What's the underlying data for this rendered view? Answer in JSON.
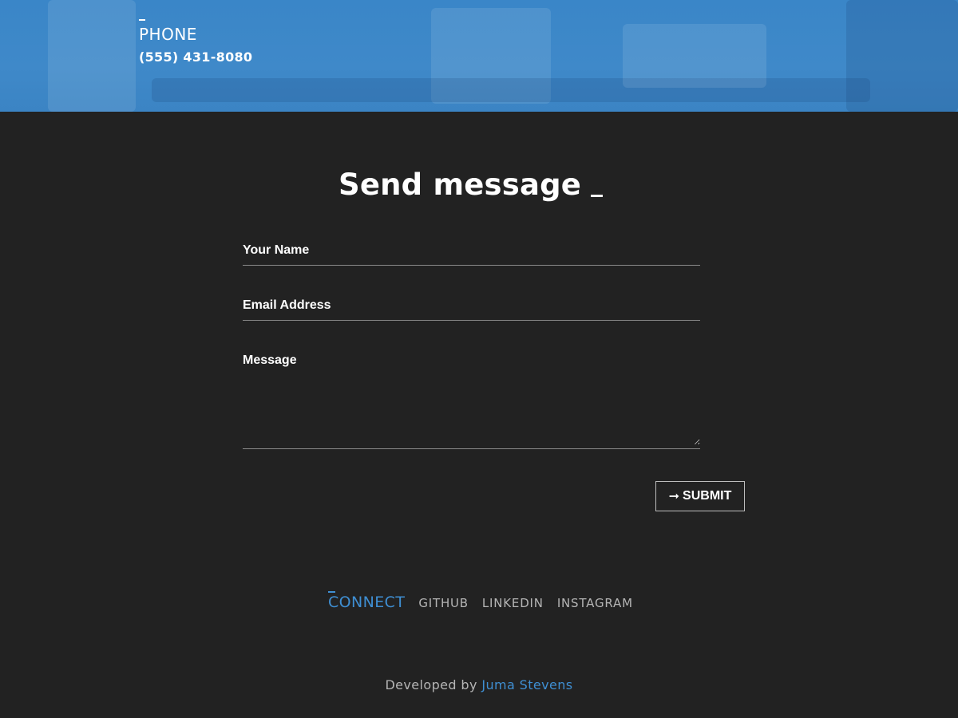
{
  "hero": {
    "phone_title": "PHONE",
    "phone_number": "(555) 431-8080",
    "background_color": "#3b86c7"
  },
  "contact_form": {
    "title": "Send message",
    "name_placeholder": "Your Name",
    "email_placeholder": "Email Address",
    "message_placeholder": "Message",
    "submit_icon": "arrow-right-icon",
    "submit_label": "SUBMIT"
  },
  "connect": {
    "label": "CONNECT",
    "links": [
      {
        "label": "GITHUB"
      },
      {
        "label": "LINKEDIN"
      },
      {
        "label": "INSTAGRAM"
      }
    ]
  },
  "footer": {
    "developed_by_text": "Developed by",
    "author": "Juma Stevens"
  },
  "colors": {
    "page_background": "#222222",
    "accent": "#3f8fd3",
    "muted_text": "#b5b5b5"
  }
}
